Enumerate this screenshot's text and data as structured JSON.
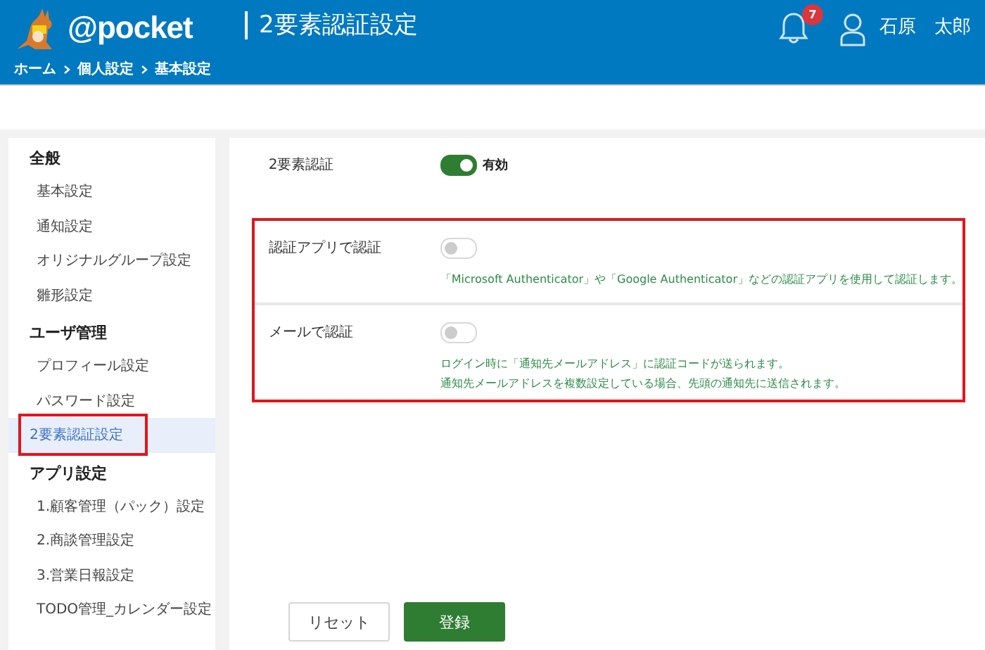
{
  "header": {
    "logo": "@pocket",
    "page_title": "2要素認証設定",
    "breadcrumb": [
      "ホーム",
      "個人設定",
      "基本設定"
    ],
    "notification_count": "7",
    "user_name": "石原　太郎"
  },
  "sidebar": {
    "sections": [
      {
        "heading": "全般",
        "items": [
          {
            "label": "基本設定",
            "selected": false,
            "highlighted": false
          },
          {
            "label": "通知設定",
            "selected": false,
            "highlighted": false
          },
          {
            "label": "オリジナルグループ設定",
            "selected": false,
            "highlighted": false
          },
          {
            "label": "雛形設定",
            "selected": false,
            "highlighted": false
          }
        ]
      },
      {
        "heading": "ユーザ管理",
        "items": [
          {
            "label": "プロフィール設定",
            "selected": false,
            "highlighted": false
          },
          {
            "label": "パスワード設定",
            "selected": false,
            "highlighted": false
          },
          {
            "label": "2要素認証設定",
            "selected": true,
            "highlighted": true
          }
        ]
      },
      {
        "heading": "アプリ設定",
        "items": [
          {
            "label": "1.顧客管理（パック）設定",
            "selected": false,
            "highlighted": false
          },
          {
            "label": "2.商談管理設定",
            "selected": false,
            "highlighted": false
          },
          {
            "label": "3.営業日報設定",
            "selected": false,
            "highlighted": false
          },
          {
            "label": "TODO管理_カレンダー設定",
            "selected": false,
            "highlighted": false
          }
        ]
      }
    ]
  },
  "settings": [
    {
      "label": "2要素認証",
      "on": true,
      "state_label": "有効",
      "highlighted": false
    },
    {
      "label": "認証アプリで認証",
      "on": false,
      "highlighted": true,
      "notes": [
        "「Microsoft Authenticator」や「Google Authenticator」などの認証アプリを使用して認証します。"
      ]
    },
    {
      "label": "メールで認証",
      "on": false,
      "highlighted": true,
      "notes": [
        "ログイン時に「通知先メールアドレス」に認証コードが送られます。",
        "通知先メールアドレスを複数設定している場合、先頭の通知先に送信されます。"
      ]
    }
  ],
  "buttons": [
    {
      "label": "リセット",
      "kind": "secondary"
    },
    {
      "label": "登録",
      "kind": "primary"
    }
  ]
}
